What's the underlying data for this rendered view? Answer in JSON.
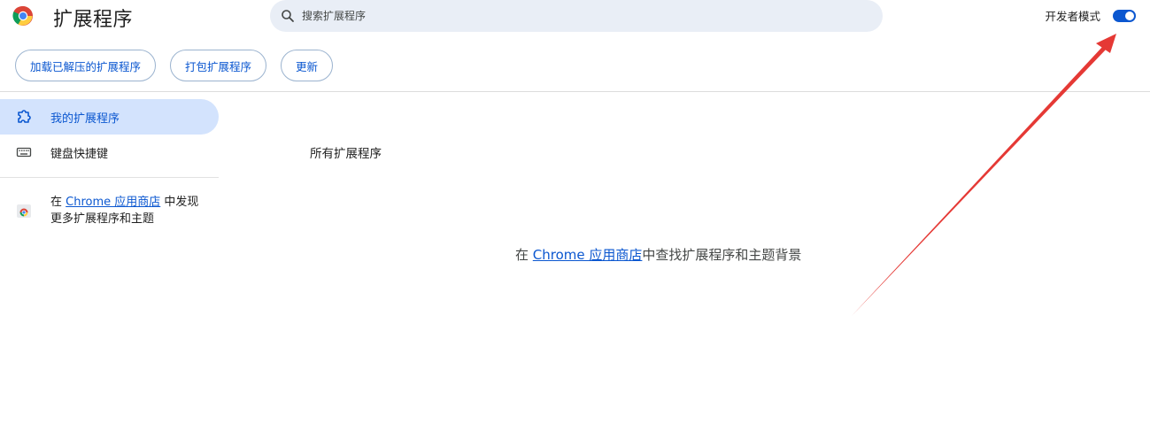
{
  "header": {
    "title": "扩展程序",
    "search_placeholder": "搜索扩展程序",
    "dev_mode_label": "开发者模式",
    "dev_mode_enabled": true
  },
  "toolbar": {
    "load_unpacked": "加载已解压的扩展程序",
    "pack": "打包扩展程序",
    "update": "更新"
  },
  "sidebar": {
    "items": [
      {
        "label": "我的扩展程序",
        "icon": "puzzle-icon",
        "active": true
      },
      {
        "label": "键盘快捷键",
        "icon": "keyboard-icon",
        "active": false
      }
    ],
    "promo": {
      "prefix": "在 ",
      "link": "Chrome 应用商店",
      "suffix": " 中发现更多扩展程序和主题",
      "icon": "chrome-web-store-icon"
    }
  },
  "main": {
    "section_title": "所有扩展程序",
    "empty": {
      "prefix": "在 ",
      "link": "Chrome 应用商店",
      "suffix": "中查找扩展程序和主题背景"
    }
  },
  "colors": {
    "accent": "#0b57d0",
    "active_bg": "#d3e3fd",
    "search_bg": "#e9eef6",
    "annotation_arrow": "#e53935"
  }
}
